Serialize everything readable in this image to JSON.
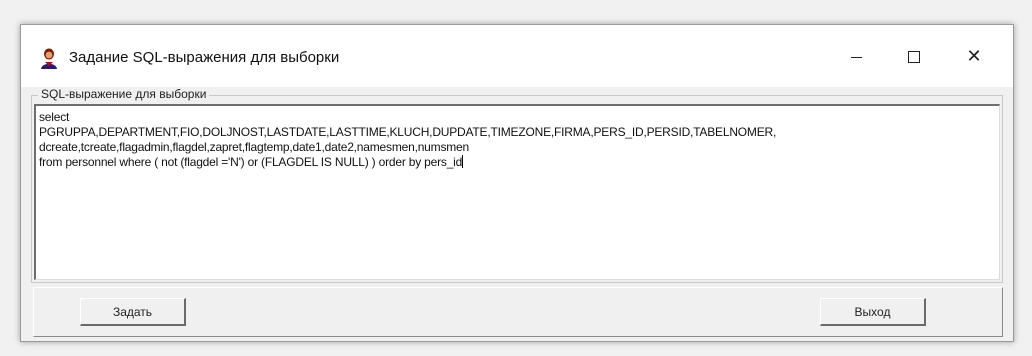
{
  "window": {
    "title": "Задание SQL-выражения для выборки",
    "controls": {
      "minimize": "minimize-icon",
      "maximize": "maximize-icon",
      "close": "close-icon"
    }
  },
  "editor": {
    "group_label": "SQL-выражение для выборки",
    "lines": [
      "select",
      "PGRUPPA,DEPARTMENT,FIO,DOLJNOST,LASTDATE,LASTTIME,KLUCH,DUPDATE,TIMEZONE,FIRMA,PERS_ID,PERSID,TABELNOMER,",
      "dcreate,tcreate,flagadmin,flagdel,zapret,flagtemp,date1,date2,namesmen,numsmen",
      "from  personnel where  ( not (flagdel ='N') or (FLAGDEL IS NULL) ) order by pers_id"
    ]
  },
  "buttons": {
    "set": "Задать",
    "exit": "Выход"
  }
}
